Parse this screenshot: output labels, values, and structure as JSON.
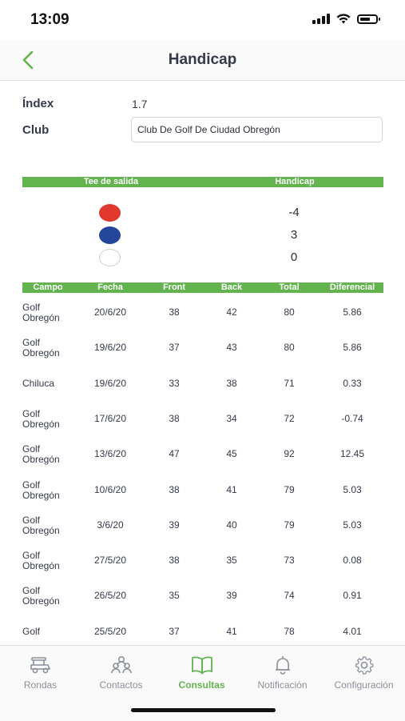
{
  "status": {
    "time": "13:09"
  },
  "nav": {
    "title": "Handicap"
  },
  "info": {
    "index_label": "Índex",
    "index_value": "1.7",
    "club_label": "Club",
    "club_value": "Club De Golf De Ciudad Obregón"
  },
  "tees": {
    "col_tee": "Tee de salida",
    "col_handicap": "Handicap",
    "rows": [
      {
        "color": "#e0372f",
        "border": "#e0372f",
        "handicap": "-4"
      },
      {
        "color": "#23469b",
        "border": "#23469b",
        "handicap": "3"
      },
      {
        "color": "#ffffff",
        "border": "#cfcfcf",
        "handicap": "0"
      }
    ]
  },
  "rounds": {
    "headers": [
      "Campo",
      "Fecha",
      "Front",
      "Back",
      "Total",
      "Diferencial"
    ],
    "rows": [
      {
        "campo": "Golf Obregón",
        "fecha": "20/6/20",
        "front": "38",
        "back": "42",
        "total": "80",
        "dif": "5.86"
      },
      {
        "campo": "Golf Obregón",
        "fecha": "19/6/20",
        "front": "37",
        "back": "43",
        "total": "80",
        "dif": "5.86"
      },
      {
        "campo": "Chiluca",
        "fecha": "19/6/20",
        "front": "33",
        "back": "38",
        "total": "71",
        "dif": "0.33"
      },
      {
        "campo": "Golf Obregón",
        "fecha": "17/6/20",
        "front": "38",
        "back": "34",
        "total": "72",
        "dif": "-0.74"
      },
      {
        "campo": "Golf Obregón",
        "fecha": "13/6/20",
        "front": "47",
        "back": "45",
        "total": "92",
        "dif": "12.45"
      },
      {
        "campo": "Golf Obregón",
        "fecha": "10/6/20",
        "front": "38",
        "back": "41",
        "total": "79",
        "dif": "5.03"
      },
      {
        "campo": "Golf Obregón",
        "fecha": "3/6/20",
        "front": "39",
        "back": "40",
        "total": "79",
        "dif": "5.03"
      },
      {
        "campo": "Golf Obregón",
        "fecha": "27/5/20",
        "front": "38",
        "back": "35",
        "total": "73",
        "dif": "0.08"
      },
      {
        "campo": "Golf Obregón",
        "fecha": "26/5/20",
        "front": "35",
        "back": "39",
        "total": "74",
        "dif": "0.91"
      },
      {
        "campo": "Golf",
        "fecha": "25/5/20",
        "front": "37",
        "back": "41",
        "total": "78",
        "dif": "4.01"
      }
    ]
  },
  "tabs": [
    {
      "label": "Rondas",
      "icon": "golf-cart-icon"
    },
    {
      "label": "Contactos",
      "icon": "contacts-icon"
    },
    {
      "label": "Consultas",
      "icon": "book-icon",
      "active": true
    },
    {
      "label": "Notificación",
      "icon": "bell-icon"
    },
    {
      "label": "Configuración",
      "icon": "gear-icon"
    }
  ],
  "colors": {
    "accent": "#63b34f",
    "text": "#353a4a",
    "tab_inactive": "#8a8f99"
  }
}
